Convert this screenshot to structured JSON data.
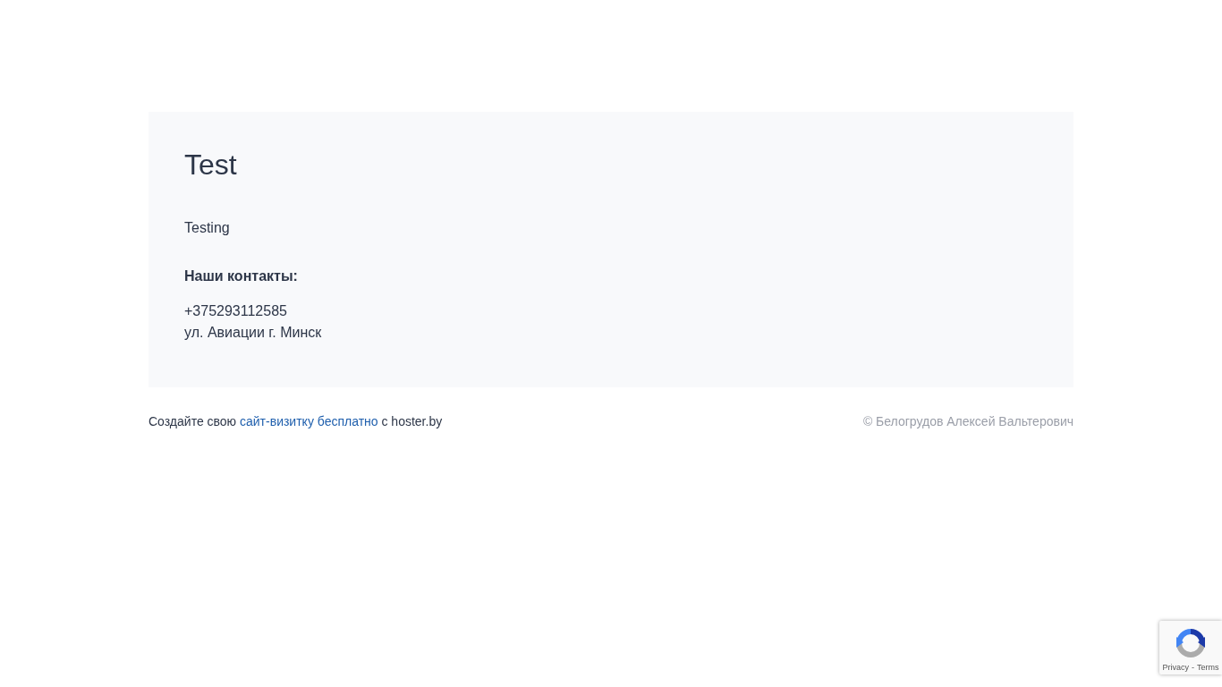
{
  "card": {
    "title": "Test",
    "description": "Testing",
    "contacts_heading": "Наши контакты:",
    "contact_lines": [
      "+375293112585",
      "ул. Авиации г. Минск"
    ]
  },
  "footer": {
    "credit_before": "Создайте свою",
    "credit_link": "сайт-визитку бесплатно",
    "credit_after": "с hoster.by",
    "copyright": "© Белогрудов Алексей Вальтерович"
  },
  "recaptcha": {
    "privacy": "Privacy",
    "separator": "-",
    "terms": "Terms"
  }
}
